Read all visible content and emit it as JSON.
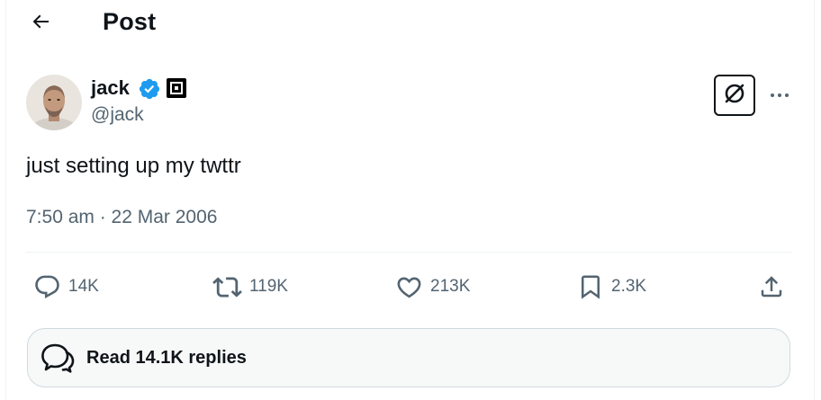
{
  "header": {
    "title": "Post"
  },
  "author": {
    "display_name": "jack",
    "handle": "@jack"
  },
  "post": {
    "text": "just setting up my twttr",
    "timestamp": "7:50 am · 22 Mar 2006"
  },
  "metrics": {
    "replies": "14K",
    "reposts": "119K",
    "likes": "213K",
    "bookmarks": "2.3K"
  },
  "replies_button": {
    "label": "Read 14.1K replies"
  },
  "colors": {
    "text": "#0f1419",
    "secondary": "#536471",
    "verified": "#1d9bf0",
    "border": "#cfd9de",
    "divider": "#eff3f4"
  },
  "icons": [
    "back-arrow-icon",
    "verified-icon",
    "affiliate-badge-icon",
    "grok-icon",
    "more-icon",
    "reply-icon",
    "repost-icon",
    "like-icon",
    "bookmark-icon",
    "share-icon",
    "replies-icon"
  ]
}
